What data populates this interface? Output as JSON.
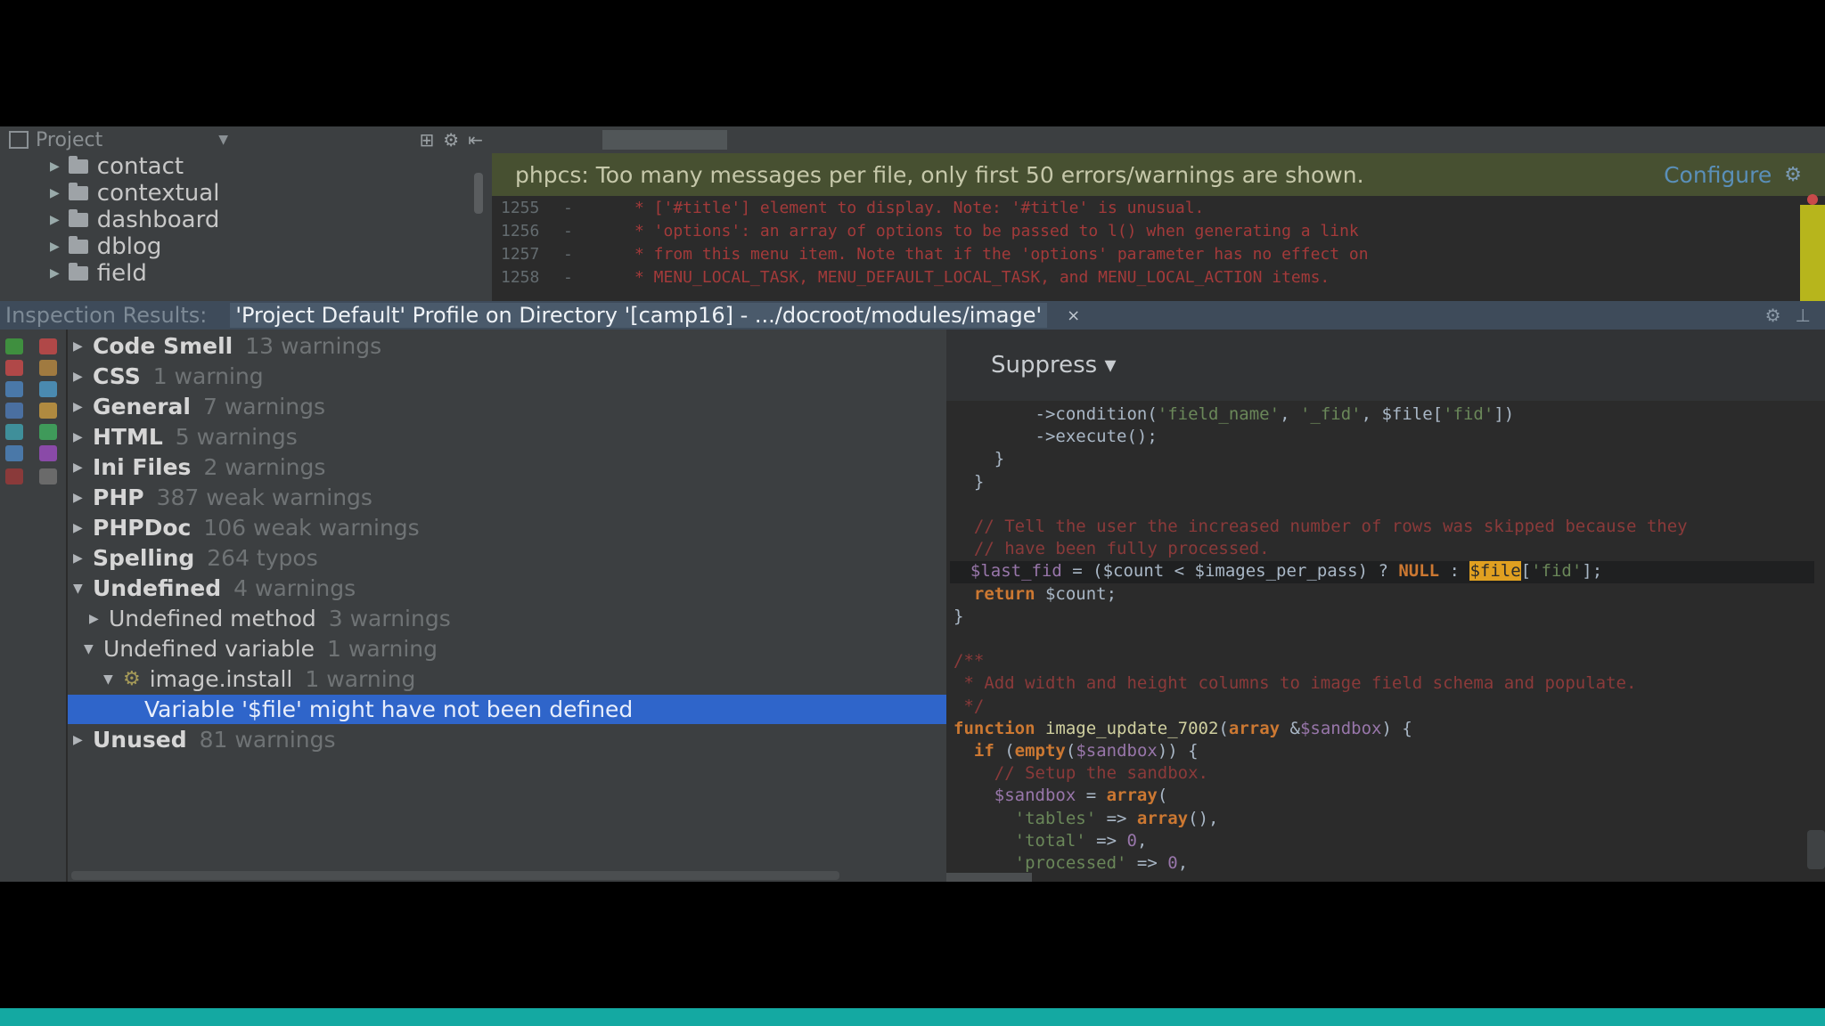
{
  "project_panel": {
    "title": "Project",
    "items": [
      {
        "label": "contact"
      },
      {
        "label": "contextual"
      },
      {
        "label": "dashboard"
      },
      {
        "label": "dblog"
      },
      {
        "label": "field"
      }
    ]
  },
  "editor": {
    "tab_label": "",
    "banner_text": "phpcs: Too many messages per file, only first 50 errors/warnings are shown.",
    "configure_label": "Configure",
    "code_lines": [
      {
        "num": "1255",
        "text": "*  ['#title'] element to display. Note: '#title' is unusual."
      },
      {
        "num": "1256",
        "text": "*  'options': an array of options to be passed to l() when generating a link"
      },
      {
        "num": "1257",
        "text": "*  from this menu item. Note that if the 'options' parameter has no effect on"
      },
      {
        "num": "1258",
        "text": "*  MENU_LOCAL_TASK, MENU_DEFAULT_LOCAL_TASK, and MENU_LOCAL_ACTION items."
      }
    ]
  },
  "inspection": {
    "title": "Inspection Results:",
    "scope": "'Project Default' Profile on Directory '[camp16] - .../docroot/modules/image'",
    "close": "×"
  },
  "tree": [
    {
      "label": "Code Smell",
      "count": "13 warnings"
    },
    {
      "label": "CSS",
      "count": "1 warning"
    },
    {
      "label": "General",
      "count": "7 warnings"
    },
    {
      "label": "HTML",
      "count": "5 warnings"
    },
    {
      "label": "Ini Files",
      "count": "2 warnings"
    },
    {
      "label": "PHP",
      "count": "387 weak warnings"
    },
    {
      "label": "PHPDoc",
      "count": "106 weak warnings"
    },
    {
      "label": "Spelling",
      "count": "264 typos"
    },
    {
      "label": "Undefined",
      "count": "4 warnings"
    },
    {
      "label": "Undefined method",
      "count": "3 warnings"
    },
    {
      "label": "Undefined variable",
      "count": "1 warning"
    },
    {
      "label": "image.install",
      "count": "1 warning"
    },
    {
      "label": "Variable '$file' might have not been defined",
      "count": ""
    },
    {
      "label": "Unused",
      "count": "81 warnings"
    }
  ],
  "preview": {
    "suppress_label": "Suppress ▾",
    "lines": [
      {
        "parts": [
          {
            "c": "pl",
            "t": "        ->condition("
          },
          {
            "c": "st",
            "t": "'field_name'"
          },
          {
            "c": "pl",
            "t": ", "
          },
          {
            "c": "st",
            "t": "'_fid'"
          },
          {
            "c": "pl",
            "t": ", $file["
          },
          {
            "c": "st",
            "t": "'fid'"
          },
          {
            "c": "pl",
            "t": "])"
          }
        ]
      },
      {
        "parts": [
          {
            "c": "pl",
            "t": "        ->execute();"
          }
        ]
      },
      {
        "parts": [
          {
            "c": "pl",
            "t": "    }"
          }
        ]
      },
      {
        "parts": [
          {
            "c": "pl",
            "t": "  }"
          }
        ]
      },
      {
        "parts": [
          {
            "c": "pl",
            "t": ""
          }
        ]
      },
      {
        "parts": [
          {
            "c": "cm",
            "t": "  // Tell the user the increased number of rows was skipped because they"
          }
        ]
      },
      {
        "parts": [
          {
            "c": "cm",
            "t": "  // have been fully processed."
          }
        ]
      },
      {
        "parts": [
          {
            "c": "pv",
            "t": "  $last_fid"
          },
          {
            "c": "pl",
            "t": " = ($count < $images_per_pass) ? "
          },
          {
            "c": "kw",
            "t": "NULL"
          },
          {
            "c": "pl",
            "t": " : "
          },
          {
            "c": "hl",
            "t": "$file"
          },
          {
            "c": "pl",
            "t": "["
          },
          {
            "c": "st",
            "t": "'fid'"
          },
          {
            "c": "pl",
            "t": "];"
          }
        ]
      },
      {
        "parts": [
          {
            "c": "kw",
            "t": "  return"
          },
          {
            "c": "pl",
            "t": " $count;"
          }
        ]
      },
      {
        "parts": [
          {
            "c": "pl",
            "t": "}"
          }
        ]
      },
      {
        "parts": [
          {
            "c": "pl",
            "t": ""
          }
        ]
      },
      {
        "parts": [
          {
            "c": "cm",
            "t": "/**"
          }
        ]
      },
      {
        "parts": [
          {
            "c": "cm",
            "t": " * Add width and height columns to image field schema and populate."
          }
        ]
      },
      {
        "parts": [
          {
            "c": "cm",
            "t": " */"
          }
        ]
      },
      {
        "parts": [
          {
            "c": "kw",
            "t": "function"
          },
          {
            "c": "fn",
            "t": " image_update_7002"
          },
          {
            "c": "pl",
            "t": "("
          },
          {
            "c": "kw",
            "t": "array"
          },
          {
            "c": "pl",
            "t": " &"
          },
          {
            "c": "pv",
            "t": "$sandbox"
          },
          {
            "c": "pl",
            "t": ") {"
          }
        ]
      },
      {
        "parts": [
          {
            "c": "kw",
            "t": "  if"
          },
          {
            "c": "pl",
            "t": " ("
          },
          {
            "c": "kw",
            "t": "empty"
          },
          {
            "c": "pl",
            "t": "("
          },
          {
            "c": "pv",
            "t": "$sandbox"
          },
          {
            "c": "pl",
            "t": ")) {"
          }
        ]
      },
      {
        "parts": [
          {
            "c": "cm",
            "t": "    // Setup the sandbox."
          }
        ]
      },
      {
        "parts": [
          {
            "c": "pv",
            "t": "    $sandbox"
          },
          {
            "c": "pl",
            "t": " = "
          },
          {
            "c": "kw",
            "t": "array"
          },
          {
            "c": "pl",
            "t": "("
          }
        ]
      },
      {
        "parts": [
          {
            "c": "st",
            "t": "      'tables'"
          },
          {
            "c": "pl",
            "t": " => "
          },
          {
            "c": "kw",
            "t": "array"
          },
          {
            "c": "pl",
            "t": "(),"
          }
        ]
      },
      {
        "parts": [
          {
            "c": "st",
            "t": "      'total'"
          },
          {
            "c": "pl",
            "t": " => "
          },
          {
            "c": "pv",
            "t": "0"
          },
          {
            "c": "pl",
            "t": ","
          }
        ]
      },
      {
        "parts": [
          {
            "c": "st",
            "t": "      'processed'"
          },
          {
            "c": "pl",
            "t": " => "
          },
          {
            "c": "pv",
            "t": "0"
          },
          {
            "c": "pl",
            "t": ","
          }
        ]
      }
    ]
  },
  "colors": {
    "accent_bottom": "#14a9a2",
    "selection": "#2f65ca",
    "banner_bg": "#475031"
  }
}
